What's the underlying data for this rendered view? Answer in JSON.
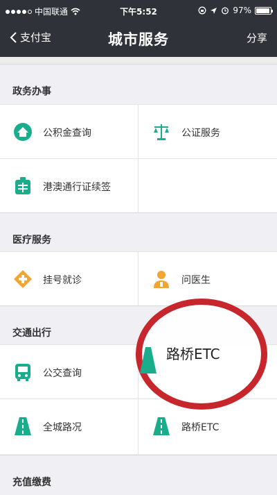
{
  "status_bar": {
    "carrier": "中国联通",
    "time": "下午5:52",
    "battery": "97%",
    "battery_level": 0.97
  },
  "nav": {
    "back_label": "支付宝",
    "title": "城市服务",
    "share_label": "分享"
  },
  "sections": [
    {
      "title": "政务办事"
    },
    {
      "title": "医疗服务"
    },
    {
      "title": "交通出行"
    },
    {
      "title": "充值缴费"
    }
  ],
  "items": {
    "gjj": "公积金查询",
    "notary": "公证服务",
    "hk_macau": "港澳通行证续签",
    "register": "挂号就诊",
    "ask_doctor": "问医生",
    "bus": "公交查询",
    "road": "全城路况",
    "etc": "路桥ETC"
  },
  "callout": {
    "label": "路桥ETC"
  },
  "colors": {
    "green": "#1aad8c",
    "orange": "#f3a534",
    "header": "#2f3238",
    "ring": "#c8262d"
  }
}
